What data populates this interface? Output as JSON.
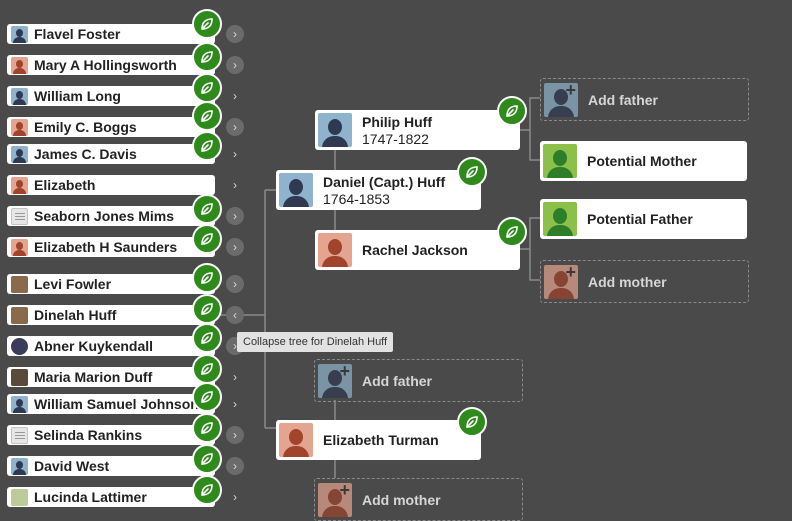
{
  "sidebar": {
    "ancestors": [
      {
        "name": "Flavel Foster",
        "thumb": "male"
      },
      {
        "name": "Mary A Hollingsworth",
        "thumb": "female"
      },
      {
        "name": "William Long",
        "thumb": "male"
      },
      {
        "name": "Emily C. Boggs",
        "thumb": "female"
      },
      {
        "name": "James C. Davis",
        "thumb": "male"
      },
      {
        "name": "Elizabeth",
        "thumb": "female"
      },
      {
        "name": "Seaborn Jones Mims",
        "thumb": "doc"
      },
      {
        "name": "Elizabeth H Saunders",
        "thumb": "female"
      },
      {
        "name": "Levi Fowler",
        "thumb": "photo"
      },
      {
        "name": "Dinelah Huff",
        "thumb": "photo"
      },
      {
        "name": "Abner Kuykendall",
        "thumb": "seal"
      },
      {
        "name": "Maria Marion Duff",
        "thumb": "tall"
      },
      {
        "name": "William Samuel Johnson",
        "thumb": "male"
      },
      {
        "name": "Selinda Rankins",
        "thumb": "doc"
      },
      {
        "name": "David West",
        "thumb": "male"
      },
      {
        "name": "Lucinda Lattimer",
        "thumb": "green"
      }
    ]
  },
  "tooltip": {
    "text": "Collapse tree for Dinelah Huff"
  },
  "tree": {
    "daniel": {
      "name": "Daniel (Capt.) Huff",
      "dates": "1764-1853"
    },
    "philip": {
      "name": "Philip Huff",
      "dates": "1747-1822"
    },
    "rachel": {
      "name": "Rachel Jackson"
    },
    "elizabeth": {
      "name": "Elizabeth Turman"
    },
    "potential_mother": {
      "label": "Potential Mother"
    },
    "potential_father": {
      "label": "Potential Father"
    },
    "add_father_1": {
      "label": "Add father"
    },
    "add_mother_1": {
      "label": "Add mother"
    },
    "add_father_2": {
      "label": "Add father"
    },
    "add_mother_2": {
      "label": "Add mother"
    }
  },
  "colors": {
    "background": "#4a4a4a",
    "hint_green": "#2f8a1c",
    "potential_green": "#8cc04a"
  },
  "icons": [
    "hint-leaf-icon",
    "chevron-right-icon",
    "chevron-left-icon",
    "person-silhouette-icon",
    "add-person-icon"
  ]
}
